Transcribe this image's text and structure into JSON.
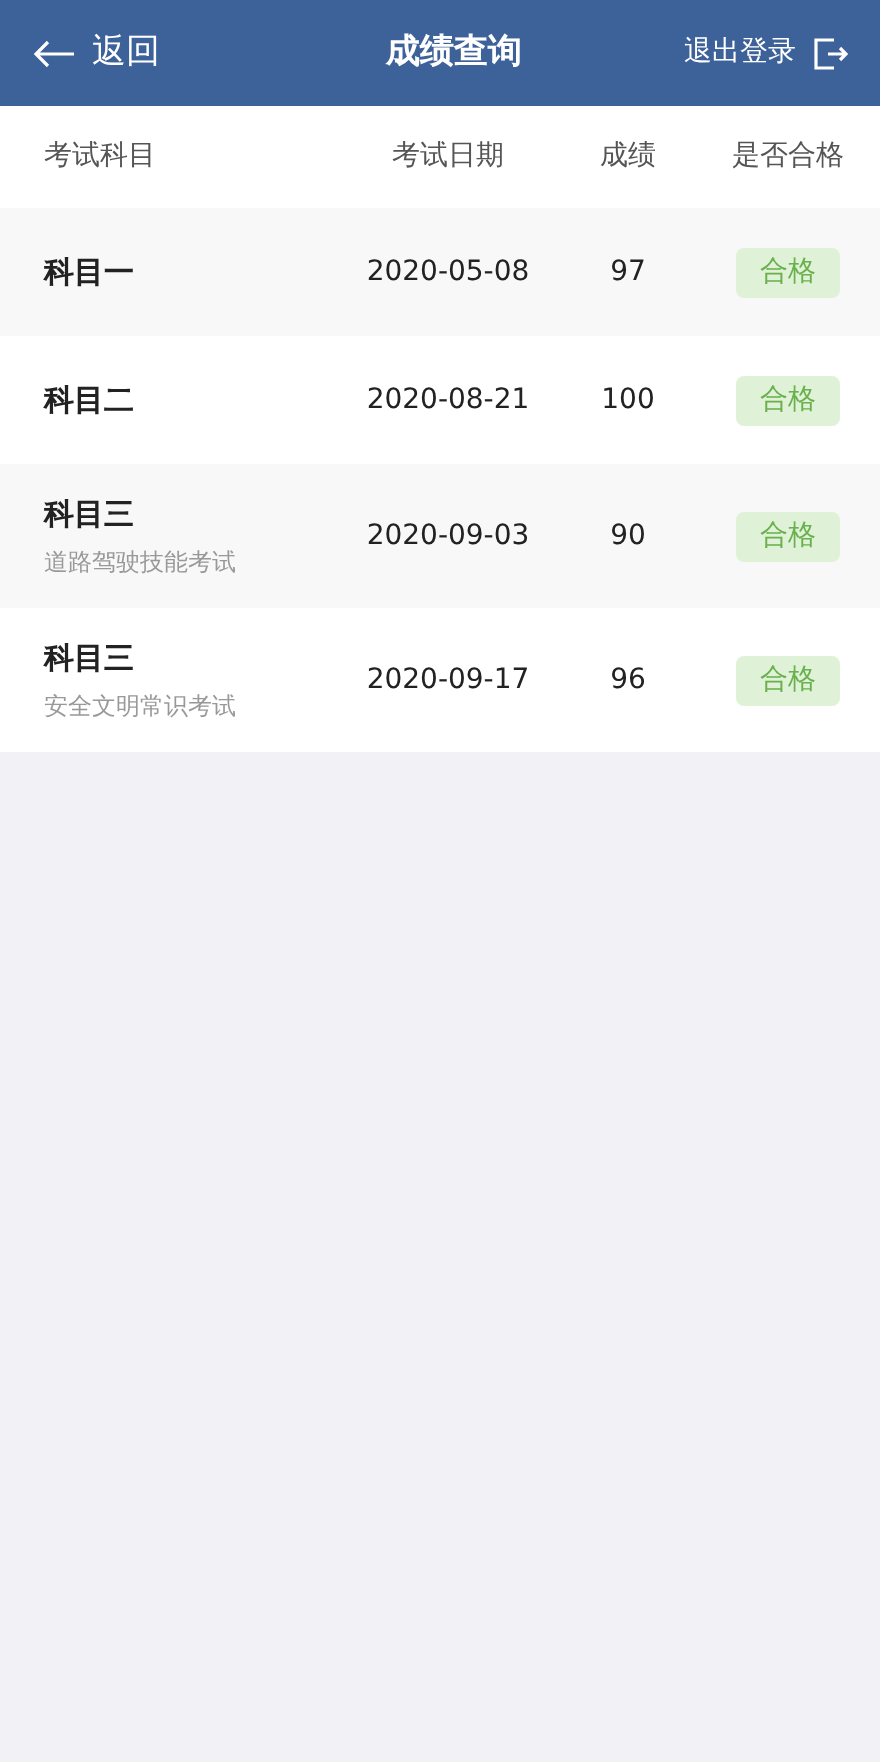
{
  "header": {
    "back_label": "返回",
    "title": "成绩查询",
    "logout_label": "退出登录"
  },
  "table": {
    "columns": [
      "考试科目",
      "考试日期",
      "成绩",
      "是否合格"
    ],
    "rows": [
      {
        "subject": "科目一",
        "date": "2020-05-08",
        "score": "97",
        "result": "合格",
        "passed": true
      },
      {
        "subject": "科目二",
        "date": "2020-08-21",
        "score": "100",
        "result": "合格",
        "passed": true
      },
      {
        "subject": "科目三",
        "subtitle": "道路驾驶技能考试",
        "date": "2020-09-03",
        "score": "90",
        "result": "合格",
        "passed": true
      },
      {
        "subject": "科目三",
        "subtitle": "安全文明常识考试",
        "date": "2020-09-17",
        "score": "96",
        "result": "合格",
        "passed": true
      }
    ]
  }
}
